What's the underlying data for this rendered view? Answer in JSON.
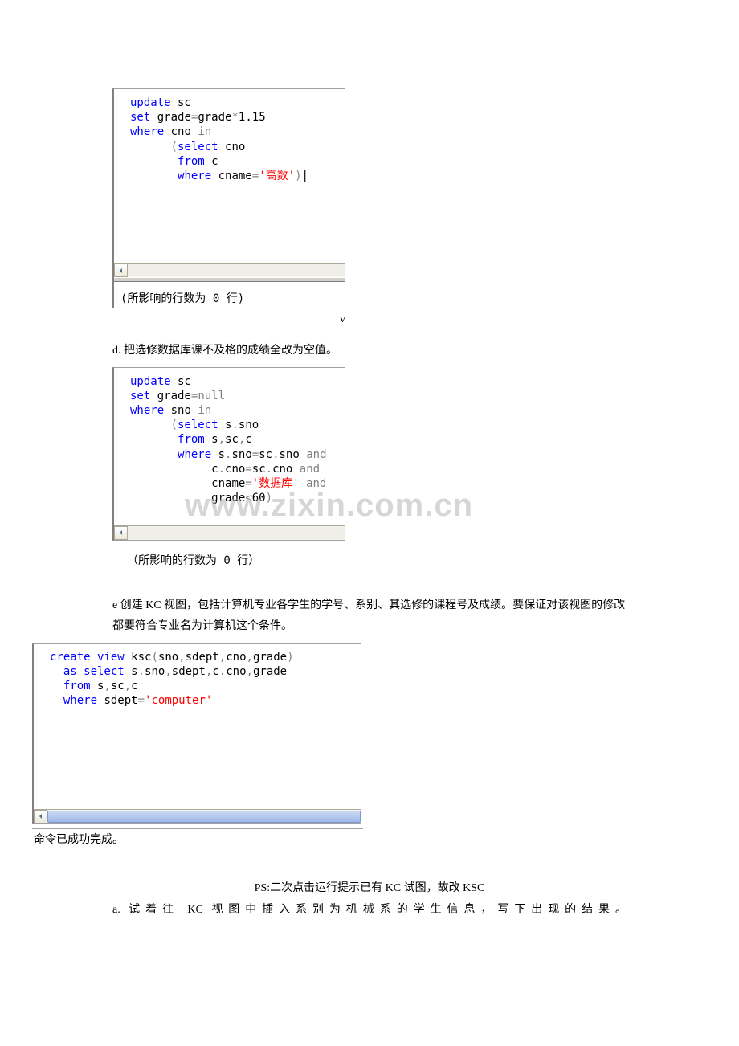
{
  "panel1": {
    "line1_kw1": "update",
    "line1_tbl": " sc",
    "line2_kw1": "set",
    "line2_col": " grade",
    "line2_eq": "=",
    "line2_expr1": "grade",
    "line2_op": "*",
    "line2_num": "1.15",
    "line3_kw1": "where",
    "line3_col": " cno ",
    "line3_kw2": "in",
    "line4_paren": "(",
    "line4_kw": "select",
    "line4_col": " cno",
    "line5_kw": "from",
    "line5_tbl": " c",
    "line6_kw": "where",
    "line6_col": " cname",
    "line6_eq": "=",
    "line6_q": "'",
    "line6_str": "高数",
    "line6_q2": "'",
    "line6_paren": ")",
    "result": "(所影响的行数为 0 行)"
  },
  "letter_v": "v",
  "item_d": "d.  把选修数据库课不及格的成绩全改为空值。",
  "panel2": {
    "l1_kw": "update",
    "l1_tbl": " sc",
    "l2_kw": "set",
    "l2_col": " grade",
    "l2_eq": "=",
    "l2_null": "null",
    "l3_kw": "where",
    "l3_col": " sno ",
    "l3_kw2": "in",
    "l4_paren": "(",
    "l4_kw": "select",
    "l4_col": " s",
    "l4_dot": ".",
    "l4_col2": "sno",
    "l5_kw": "from",
    "l5_tbls": " s",
    "l5_c1": ",",
    "l5_t2": "sc",
    "l5_c2": ",",
    "l5_t3": "c",
    "l6_kw": "where",
    "l6_a": " s",
    "l6_d1": ".",
    "l6_b": "sno",
    "l6_eq": "=",
    "l6_c": "sc",
    "l6_d2": ".",
    "l6_dcol": "sno ",
    "l6_and": "and",
    "l7_a": "c",
    "l7_d1": ".",
    "l7_b": "cno",
    "l7_eq": "=",
    "l7_c": "sc",
    "l7_d2": ".",
    "l7_dcol": "cno ",
    "l7_and": "and",
    "l8_a": "cname",
    "l8_eq": "=",
    "l8_q": "'",
    "l8_str": "数据库",
    "l8_q2": "'",
    "l8_sp": " ",
    "l8_and": "and",
    "l9_a": "grade",
    "l9_lt": "<",
    "l9_num": "60",
    "l9_paren": ")",
    "result": "（所影响的行数为 0 行）"
  },
  "watermark": "www.zixin.com.cn",
  "para_e": "e 创建 KC 视图，包括计算机专业各学生的学号、系别、其选修的课程号及成绩。要保证对该视图的修改都要符合专业名为计算机这个条件。",
  "panel3": {
    "l1_kw1": "create",
    "l1_kw2": " view",
    "l1_name": " ksc",
    "l1_p1": "(",
    "l1_c1": "sno",
    "l1_cm1": ",",
    "l1_c2": "sdept",
    "l1_cm2": ",",
    "l1_c3": "cno",
    "l1_cm3": ",",
    "l1_c4": "grade",
    "l1_p2": ")",
    "l2_kw1": "as",
    "l2_kw2": " select",
    "l2_a": " s",
    "l2_d1": ".",
    "l2_b": "sno",
    "l2_cm1": ",",
    "l2_c": "sdept",
    "l2_cm2": ",",
    "l2_d": "c",
    "l2_d2": ".",
    "l2_e": "cno",
    "l2_cm3": ",",
    "l2_f": "grade",
    "l3_kw": "from",
    "l3_a": " s",
    "l3_cm1": ",",
    "l3_b": "sc",
    "l3_cm2": ",",
    "l3_c": "c",
    "l4_kw": "where",
    "l4_col": " sdept",
    "l4_eq": "=",
    "l4_q": "'",
    "l4_str": "computer",
    "l4_q2": "'",
    "result": "命令已成功完成。"
  },
  "ps": "PS:二次点击运行提示已有 KC 试图，故改 KSC",
  "item_a": "a.  试着往 KC 视图中插入系别为机械系的学生信息，写下出现的结果。"
}
